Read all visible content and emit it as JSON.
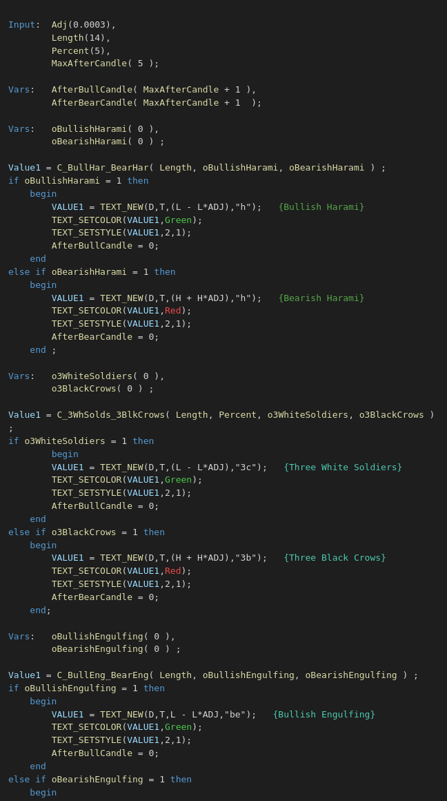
{
  "code": {
    "lines": []
  }
}
